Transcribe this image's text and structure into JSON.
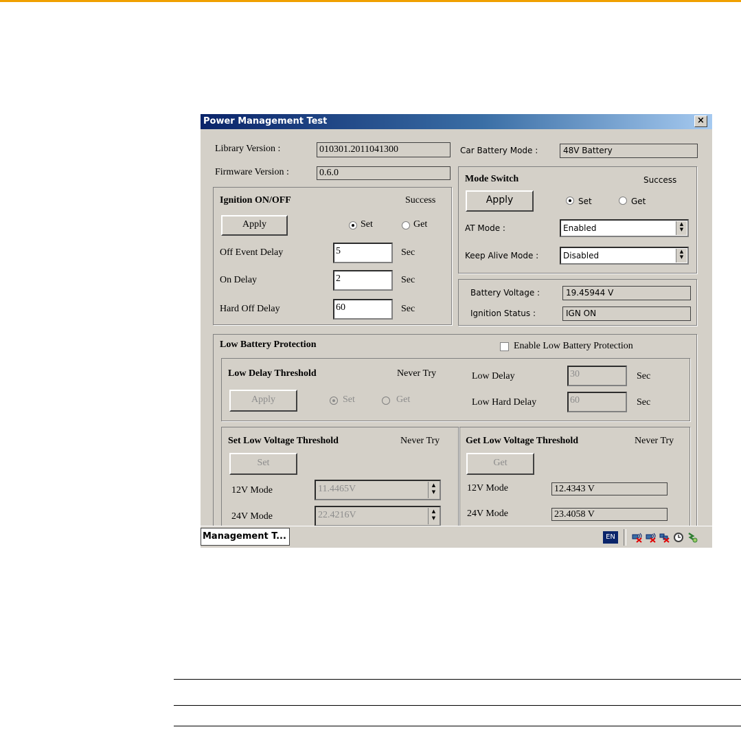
{
  "window": {
    "title": "Power Management Test",
    "close_glyph": "×"
  },
  "library_version": {
    "label": "Library Version :",
    "value": "010301.2011041300"
  },
  "firmware_version": {
    "label": "Firmware Version :",
    "value": "0.6.0"
  },
  "car_battery_mode": {
    "label": "Car Battery Mode :",
    "value": "48V Battery"
  },
  "ignition": {
    "title": "Ignition ON/OFF",
    "status": "Success",
    "apply_label": "Apply",
    "set_label": "Set",
    "get_label": "Get",
    "selected": "Set",
    "off_event_delay": {
      "label": "Off Event Delay",
      "value": "5",
      "unit": "Sec"
    },
    "on_delay": {
      "label": "On Delay",
      "value": "2",
      "unit": "Sec"
    },
    "hard_off_delay": {
      "label": "Hard Off Delay",
      "value": "60",
      "unit": "Sec"
    }
  },
  "mode_switch": {
    "title": "Mode Switch",
    "status": "Success",
    "apply_label": "Apply",
    "set_label": "Set",
    "get_label": "Get",
    "selected": "Set",
    "at_mode": {
      "label": "AT Mode :",
      "value": "Enabled"
    },
    "keep_alive_mode": {
      "label": "Keep Alive Mode :",
      "value": "Disabled"
    }
  },
  "status_panel": {
    "battery_voltage": {
      "label": "Battery Voltage :",
      "value": "19.45944 V"
    },
    "ignition_status": {
      "label": "Ignition Status :",
      "value": "IGN ON"
    }
  },
  "low_battery": {
    "title": "Low Battery Protection",
    "enable_label": "Enable Low Battery Protection",
    "enable_checked": false,
    "low_delay_threshold": {
      "title": "Low Delay Threshold",
      "status": "Never Try",
      "apply_label": "Apply",
      "set_label": "Set",
      "get_label": "Get",
      "selected": "Set",
      "low_delay": {
        "label": "Low Delay",
        "value": "30",
        "unit": "Sec"
      },
      "low_hard_delay": {
        "label": "Low Hard Delay",
        "value": "60",
        "unit": "Sec"
      }
    },
    "set_low_voltage": {
      "title": "Set Low Voltage Threshold",
      "status": "Never Try",
      "button_label": "Set",
      "mode_12v": {
        "label": "12V Mode",
        "value": "11.4465V"
      },
      "mode_24v": {
        "label": "24V Mode",
        "value": "22.4216V"
      }
    },
    "get_low_voltage": {
      "title": "Get Low Voltage Threshold",
      "status": "Never Try",
      "button_label": "Get",
      "mode_12v": {
        "label": "12V Mode",
        "value": "12.4343 V"
      },
      "mode_24v": {
        "label": "24V Mode",
        "value": "23.4058 V"
      }
    }
  },
  "taskbar": {
    "task_label": "Management T...",
    "language": "EN",
    "tray_icons": [
      "network-disconnected-icon",
      "network-disconnected-icon",
      "network-disconnected-icon",
      "clock-icon",
      "tray-app-icon"
    ]
  }
}
